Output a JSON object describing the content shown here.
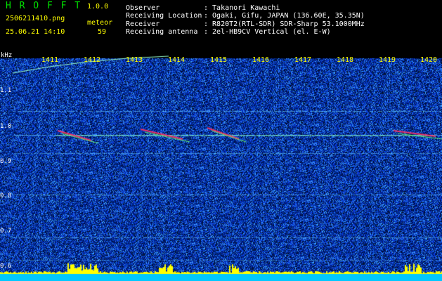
{
  "header": {
    "app_name": "H R O F F T",
    "version": "1.0.0",
    "filename": "2506211410.png",
    "datetime": "25.06.21 14:10",
    "meteor_label": "meteor",
    "meteor_count": "59",
    "fields": [
      {
        "label": "Observer",
        "value": ": Takanori Kawachi"
      },
      {
        "label": "Receiving Location",
        "value": ": Ogaki, Gifu, JAPAN (136.60E, 35.35N)"
      },
      {
        "label": "Receiver",
        "value": ": R820T2(RTL-SDR) SDR-Sharp 53.1000MHz"
      },
      {
        "label": "Receiving antenna",
        "value": ": 2el-HB9CV Vertical (el. E-W)"
      }
    ]
  },
  "spectrogram": {
    "y_unit": "kHz",
    "y_ticks": [
      "1.1",
      "1.0",
      "0.9",
      "0.8",
      "0.7",
      "0.6"
    ],
    "x_ticks": [
      "1411",
      "1412",
      "1413",
      "1414",
      "1415",
      "1416",
      "1417",
      "1418",
      "1419",
      "1420"
    ],
    "colors": {
      "background": "#000000",
      "noise_dark": "#00106a",
      "noise_light": "#2a5cff",
      "line": "#66ccff",
      "meteor": "#ff3366",
      "activity": "#ffff00",
      "baseline": "#00c8ff"
    }
  }
}
